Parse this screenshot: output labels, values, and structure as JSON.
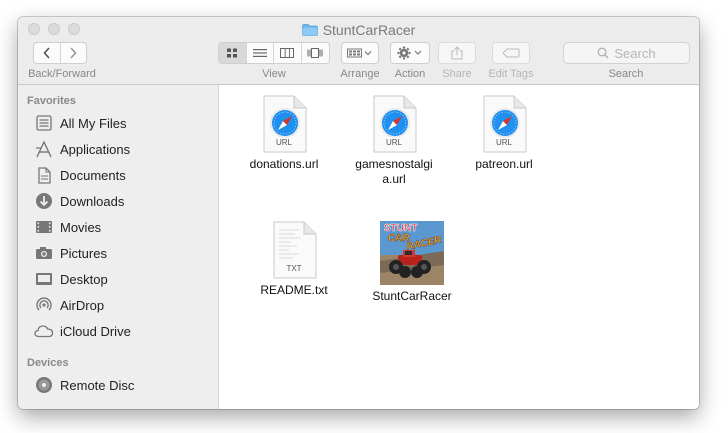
{
  "window": {
    "title": "StuntCarRacer"
  },
  "toolbar": {
    "back_forward_label": "Back/Forward",
    "view_label": "View",
    "arrange_label": "Arrange",
    "action_label": "Action",
    "share_label": "Share",
    "edit_tags_label": "Edit Tags",
    "search_label": "Search",
    "search_placeholder": "Search"
  },
  "sidebar": {
    "favorites_header": "Favorites",
    "favorites": [
      {
        "label": "All My Files",
        "icon": "all-files-icon"
      },
      {
        "label": "Applications",
        "icon": "applications-icon"
      },
      {
        "label": "Documents",
        "icon": "documents-icon"
      },
      {
        "label": "Downloads",
        "icon": "downloads-icon"
      },
      {
        "label": "Movies",
        "icon": "movies-icon"
      },
      {
        "label": "Pictures",
        "icon": "pictures-icon"
      },
      {
        "label": "Desktop",
        "icon": "desktop-icon"
      },
      {
        "label": "AirDrop",
        "icon": "airdrop-icon"
      },
      {
        "label": "iCloud Drive",
        "icon": "cloud-icon"
      }
    ],
    "devices_header": "Devices",
    "devices": [
      {
        "label": "Remote Disc",
        "icon": "disc-icon"
      }
    ]
  },
  "files": [
    {
      "name": "donations.url",
      "kind": "url",
      "ext": "URL"
    },
    {
      "name": "gamesnostalgia.url",
      "kind": "url",
      "ext": "URL"
    },
    {
      "name": "patreon.url",
      "kind": "url",
      "ext": "URL"
    },
    {
      "name": "README.txt",
      "kind": "txt",
      "ext": "TXT"
    },
    {
      "name": "StuntCarRacer",
      "kind": "app",
      "ext": ""
    }
  ],
  "thumbnail": {
    "line1": "STUNT",
    "line2": "CAR",
    "line3": "RACER"
  },
  "colors": {
    "safari_blue": "#1f8ff0",
    "accent_red": "#d9342b"
  }
}
